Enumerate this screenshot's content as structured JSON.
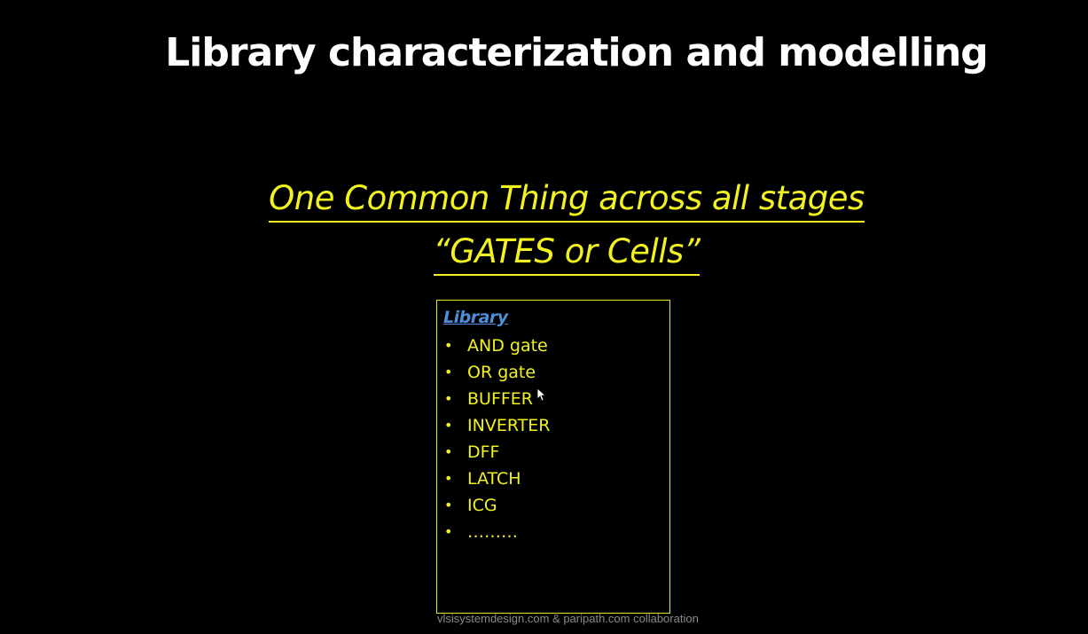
{
  "slide": {
    "title": "Library characterization and modelling",
    "subtitle_lines": [
      "One Common Thing across all stages",
      "“GATES or Cells”"
    ]
  },
  "library_box": {
    "heading": "Library",
    "bullet": "•",
    "items": [
      "AND gate",
      "OR gate",
      "BUFFER",
      "INVERTER",
      "DFF",
      "LATCH",
      "ICG",
      "………"
    ]
  },
  "footer": {
    "text": "vlsisystemdesign.com & paripath.com collaboration"
  },
  "colors": {
    "background": "#000000",
    "title": "#ffffff",
    "accent_yellow": "#f2f21e",
    "heading_blue": "#4f8fd9",
    "footer_gray": "#8a8a8a"
  },
  "icons": {
    "cursor": "mouse-pointer-icon"
  }
}
